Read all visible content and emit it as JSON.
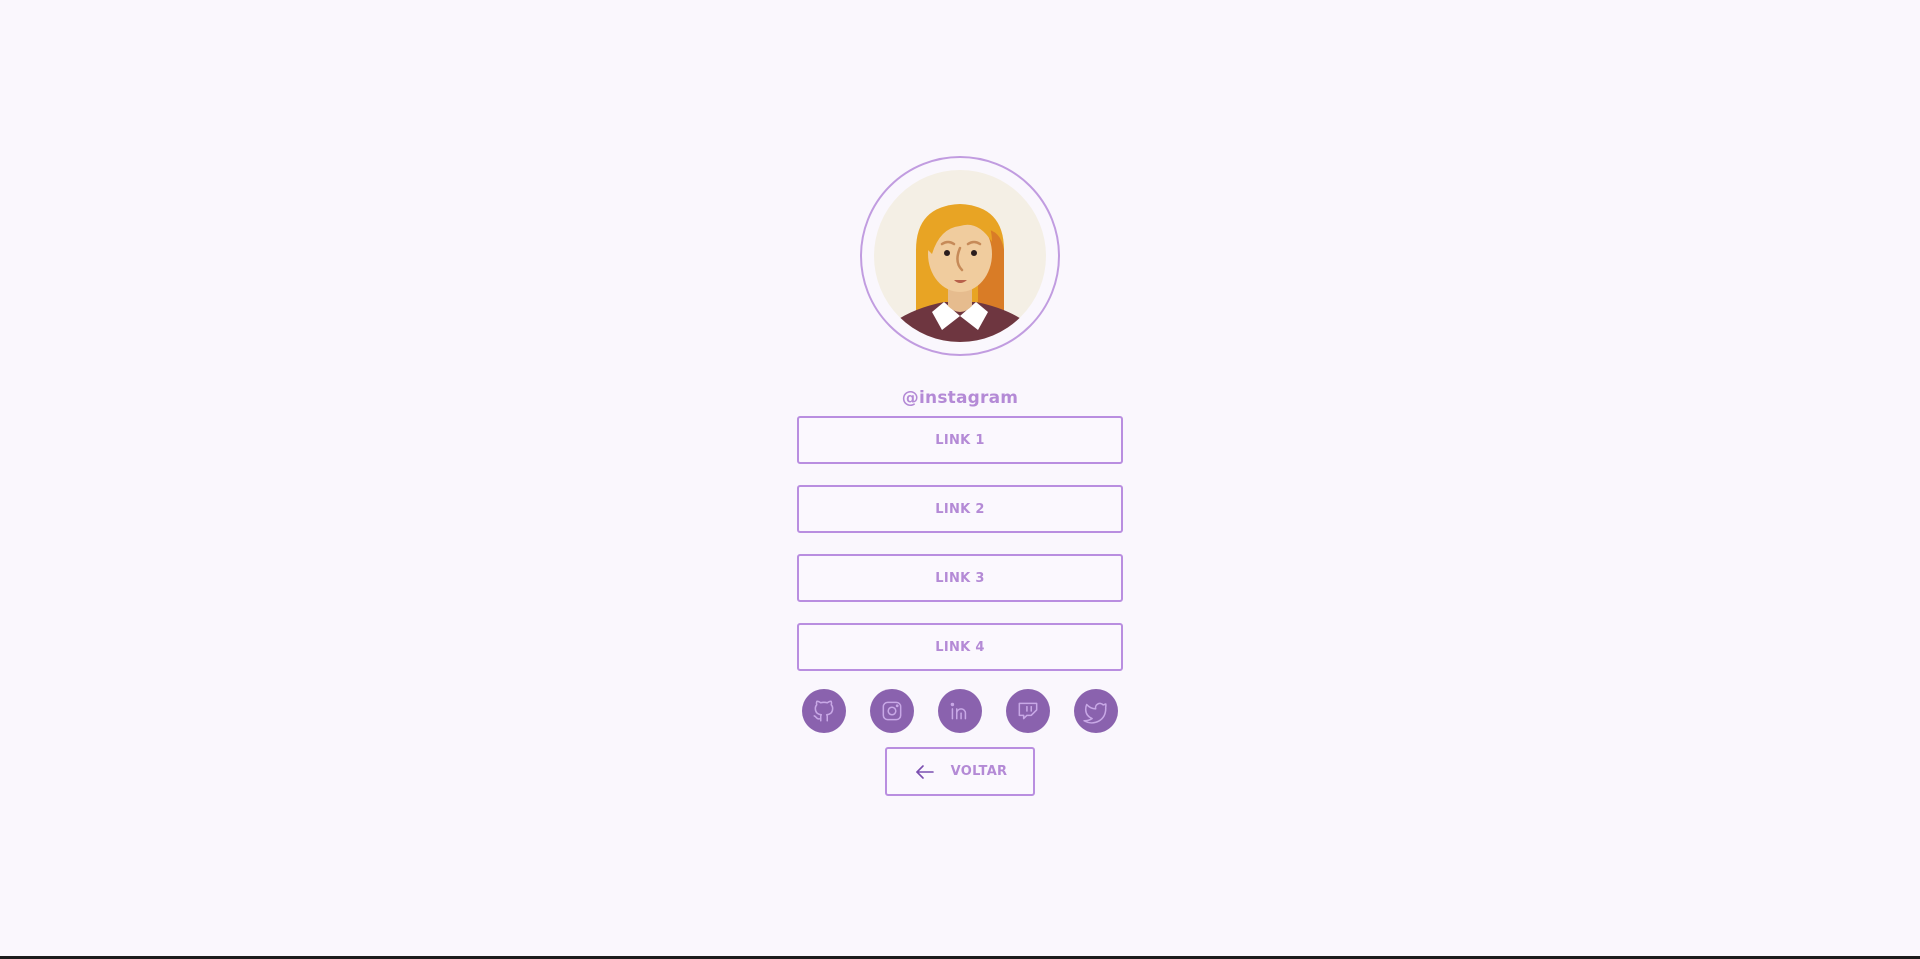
{
  "profile": {
    "handle": "@instagram",
    "avatar_icon": "woman-avatar-illustration"
  },
  "links": [
    {
      "label": "LINK 1"
    },
    {
      "label": "LINK 2"
    },
    {
      "label": "LINK 3"
    },
    {
      "label": "LINK 4"
    }
  ],
  "socials": [
    {
      "icon": "github-icon"
    },
    {
      "icon": "instagram-icon"
    },
    {
      "icon": "linkedin-icon"
    },
    {
      "icon": "twitch-icon"
    },
    {
      "icon": "twitter-icon"
    }
  ],
  "back": {
    "label": "VOLTAR",
    "icon": "arrow-left-icon"
  },
  "colors": {
    "background": "#faf7fd",
    "accent": "#b48ad6",
    "border": "#b98ee0",
    "social_bg": "#8a62ae"
  }
}
